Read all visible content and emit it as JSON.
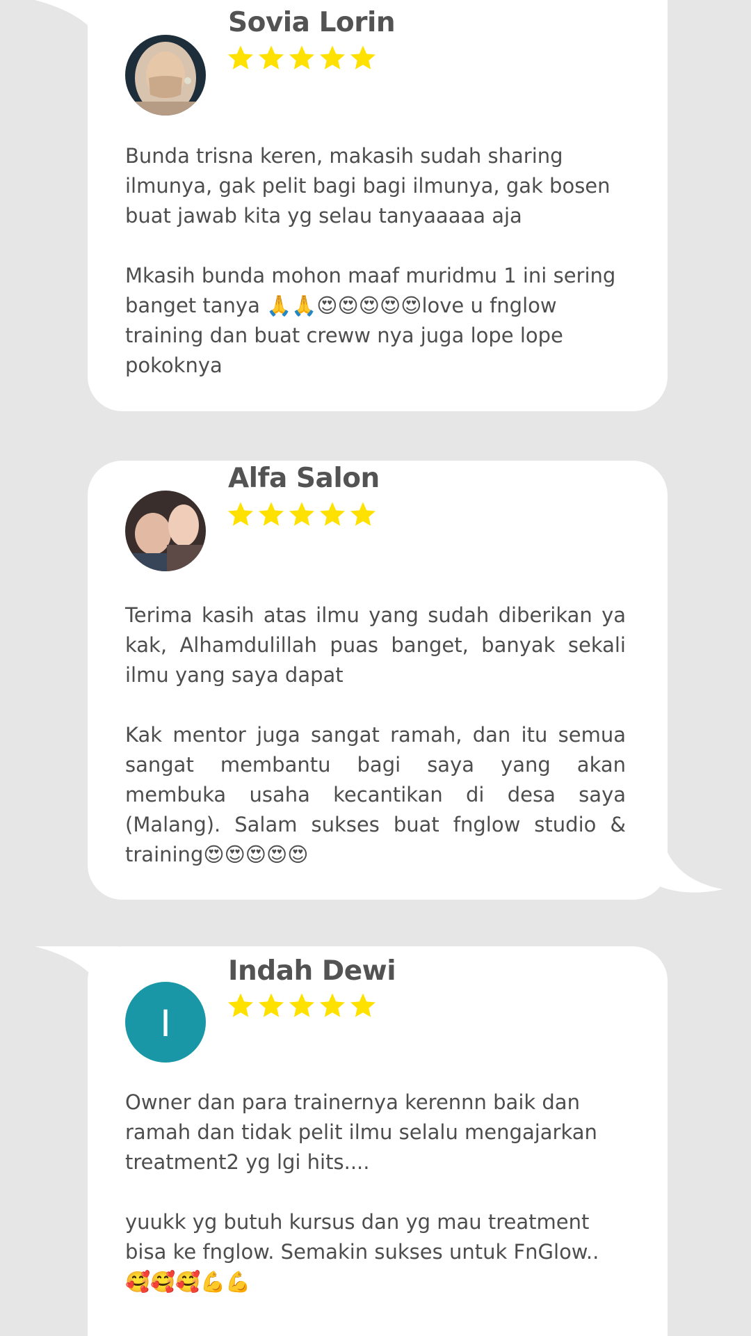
{
  "colors": {
    "background": "#e6e6e6",
    "card": "#ffffff",
    "name_text": "#535353",
    "review_text": "#4d4d4d",
    "star": "#ffe100",
    "initial_avatar": "#1997a7"
  },
  "reviews": [
    {
      "name": "Sovia Lorin",
      "rating": 5,
      "avatar": "photo-woman-hijab-mask",
      "text": "Bunda trisna keren, makasih sudah sharing ilmunya, gak pelit bagi bagi ilmunya, gak bosen buat jawab kita yg selau tanyaaaaa aja\n\nMkasih bunda mohon maaf muridmu 1 ini sering banget tanya 🙏🙏😍😍😍😍😍love u fnglow training dan buat creww nya juga lope lope pokoknya"
    },
    {
      "name": "Alfa Salon",
      "rating": 5,
      "avatar": "photo-woman-with-baby",
      "text": "Terima kasih atas ilmu yang sudah diberikan ya kak, Alhamdulillah puas banget, banyak sekali ilmu yang saya dapat\n\nKak mentor juga sangat ramah, dan itu semua sangat membantu bagi saya yang akan membuka usaha kecantikan di desa saya (Malang). Salam sukses buat fnglow studio & training😍😍😍😍😍"
    },
    {
      "name": "Indah Dewi",
      "rating": 5,
      "avatar_initial": "I",
      "text": "Owner dan para trainernya kerennn baik dan ramah dan tidak pelit ilmu selalu mengajarkan treatment2 yg lgi hits....\n\nyuukk yg butuh kursus dan yg mau treatment bisa ke fnglow. Semakin sukses untuk FnGlow.. 🥰🥰🥰💪💪"
    }
  ]
}
